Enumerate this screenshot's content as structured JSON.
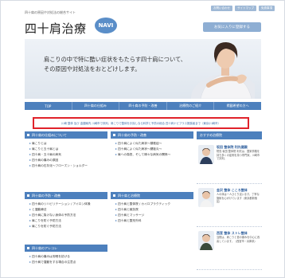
{
  "header": {
    "tagline": "四十肩の原因や対処法の総合サイト",
    "top_links": [
      "お問い合わせ",
      "サイトマップ",
      "免責事項"
    ],
    "logo_text": "四十肩治療",
    "logo_badge": "NAVI",
    "favorite_button": "お気に入りに登録する"
  },
  "hero": {
    "line1": "肩こりの中で特に酷い症状をもたらす四十肩について、",
    "line2": "その原因や対処法をおとどけします。"
  },
  "nav": {
    "items": [
      "TOP",
      "四十肩の仕組み",
      "四十肩の予防・改善",
      "治療院のご紹介",
      "掲載希望の方へ"
    ]
  },
  "notice": "川崎 整体 及び 金額案内 川崎市で評判。肩こりで整体をお探しなら科学と予防の総合 四十肩ナビプラス推奨者まで（東京/川崎市）",
  "sections": {
    "about": {
      "title": "四十肩の仕組みについて",
      "items": [
        "肩こりとは",
        "肩こりと五十肩とは",
        "四十肩・五十肩の病気",
        "四十肩の痛みの原因",
        "四十肩の石灰化〜フローズン・ショルダー"
      ]
    },
    "prevention": {
      "title": "四十肩の予防・改善",
      "items": [
        "四十肩によく似た病状〜頸椎症〜",
        "四十肩によく似た病状〜腱板炎〜",
        "肩への負担、そして様々な病気の関係〜"
      ]
    },
    "symptoms": {
      "title": "四十肩の予防・改善",
      "items": [
        "四十肩のリハビリテーション / アイロン体操",
        "と運動療法",
        "四十肩に負けない身体の予防方法",
        "肩こりを防ぐ予防方法",
        "肩こりを防ぐ予防方法"
      ]
    },
    "treatment": {
      "title": "四十肩と治療院",
      "items": [
        "四十肩と整体院 / カイロプラクティック",
        "四十肩と鍼灸院",
        "四十肩とマッサージ",
        "四十肩と整形外科"
      ]
    },
    "misc": {
      "title": "四十肩のアレコレ",
      "items": [
        "四十肩の痛みは安眠を妨げる",
        "四十肩で運動をする場合の注意点"
      ]
    }
  },
  "sidebar": {
    "title": "おすすめ治療院",
    "doctors": [
      {
        "name": "坂田 整体院 利光健親",
        "body": "院長 坂田 整体院 利光は、国家資格を持ち多くの症例を持つ専門家。川崎市で評判。"
      },
      {
        "name": "金沢 整体 こころ整体",
        "body": "人の体は一人ひとり違います。丁寧な施術を心がけています（東京都新宿区）"
      },
      {
        "name": "西宮 整体 ストレ整体",
        "body": "当院は、肩こりと首の痛みを中心に改善しています。（西宮市・兵庫県）"
      }
    ]
  },
  "colors": {
    "accent": "#4d80bd",
    "highlight_border": "#e0232b"
  }
}
